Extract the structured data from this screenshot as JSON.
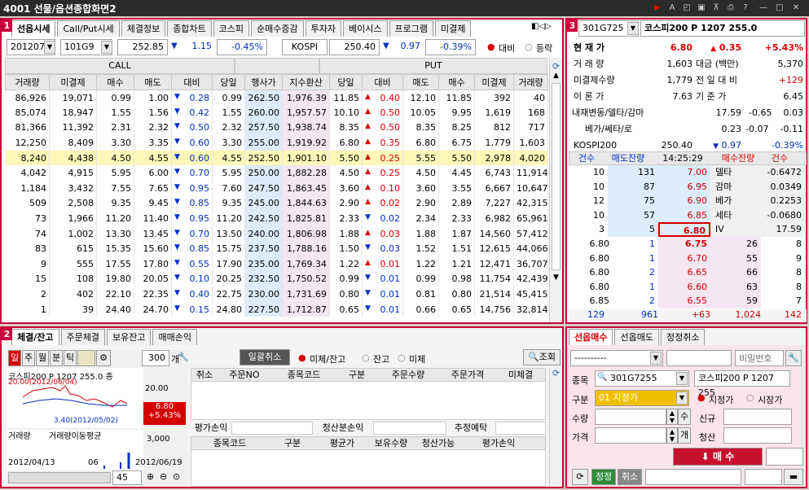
{
  "window": {
    "title": "4001 선물/옵션종합화면2"
  },
  "panel1": {
    "tabs": [
      "선옵시세",
      "Call/Put시세",
      "체결정보",
      "종합차트",
      "코스피",
      "순매수증감",
      "투자자",
      "베이시스",
      "프로그램",
      "미결제"
    ],
    "month": "201207",
    "fut_code": "101G9",
    "fut_price": "252.85",
    "fut_change": "1.15",
    "fut_rate": "-0.45%",
    "kospi_label": "KOSPI",
    "kospi_price": "250.40",
    "kospi_change": "0.97",
    "kospi_rate": "-0.39%",
    "radio_diff": "대비",
    "radio_rate": "등락",
    "call_label": "CALL",
    "put_label": "PUT",
    "headers": [
      "거래량",
      "미결제",
      "매수",
      "매도",
      "대비",
      "당일",
      "행사가",
      "지수환산",
      "당일",
      "대비",
      "매도",
      "매수",
      "미결제",
      "거래량"
    ],
    "rows": [
      [
        "86,926",
        "19,071",
        "0.99",
        "1.00",
        "dn",
        "0.28",
        "0.99",
        "262.50",
        "1,976.39",
        "11.85",
        "up",
        "0.40",
        "12.10",
        "11.85",
        "392",
        "40"
      ],
      [
        "85,074",
        "18,947",
        "1.55",
        "1.56",
        "dn",
        "0.42",
        "1.55",
        "260.00",
        "1,957.57",
        "10.10",
        "up",
        "0.50",
        "10.05",
        "9.95",
        "1,619",
        "168"
      ],
      [
        "81,366",
        "11,392",
        "2.31",
        "2.32",
        "dn",
        "0.50",
        "2.32",
        "257.50",
        "1,938.74",
        "8.35",
        "up",
        "0.50",
        "8.35",
        "8.25",
        "812",
        "717"
      ],
      [
        "12,250",
        "8,409",
        "3.30",
        "3.35",
        "dn",
        "0.60",
        "3.30",
        "255.00",
        "1,919.92",
        "6.80",
        "up",
        "0.35",
        "6.80",
        "6.75",
        "1,779",
        "1,603"
      ],
      [
        "8,240",
        "4,438",
        "4.50",
        "4.55",
        "dn",
        "0.60",
        "4.55",
        "252.50",
        "1,901.10",
        "5.50",
        "up",
        "0.25",
        "5.55",
        "5.50",
        "2,978",
        "4,020"
      ],
      [
        "4,042",
        "4,915",
        "5.95",
        "6.00",
        "dn",
        "0.70",
        "5.95",
        "250.00",
        "1,882.28",
        "4.50",
        "up",
        "0.25",
        "4.50",
        "4.45",
        "6,743",
        "11,914"
      ],
      [
        "1,184",
        "3,432",
        "7.55",
        "7.65",
        "dn",
        "0.95",
        "7.60",
        "247.50",
        "1,863.45",
        "3.60",
        "up",
        "0.10",
        "3.60",
        "3.55",
        "6,667",
        "10,647"
      ],
      [
        "509",
        "2,508",
        "9.35",
        "9.45",
        "dn",
        "0.85",
        "9.35",
        "245.00",
        "1,844.63",
        "2.90",
        "up",
        "0.02",
        "2.90",
        "2.89",
        "7,227",
        "42,315"
      ],
      [
        "73",
        "1,966",
        "11.20",
        "11.40",
        "dn",
        "0.95",
        "11.20",
        "242.50",
        "1,825.81",
        "2.33",
        "dn",
        "0.02",
        "2.34",
        "2.33",
        "6,982",
        "65,961"
      ],
      [
        "74",
        "1,002",
        "13.30",
        "13.45",
        "dn",
        "0.70",
        "13.50",
        "240.00",
        "1,806.98",
        "1.88",
        "up",
        "0.03",
        "1.88",
        "1.87",
        "14,560",
        "57,412"
      ],
      [
        "83",
        "615",
        "15.35",
        "15.60",
        "dn",
        "0.85",
        "15.75",
        "237.50",
        "1,788.16",
        "1.50",
        "dn",
        "0.03",
        "1.52",
        "1.51",
        "12,615",
        "44,066"
      ],
      [
        "9",
        "555",
        "17.55",
        "17.80",
        "dn",
        "0.55",
        "17.90",
        "235.00",
        "1,769.34",
        "1.22",
        "up",
        "0.01",
        "1.22",
        "1.21",
        "12,471",
        "36,707"
      ],
      [
        "15",
        "108",
        "19.80",
        "20.05",
        "dn",
        "0.10",
        "20.25",
        "232.50",
        "1,750.52",
        "0.99",
        "dn",
        "0.01",
        "0.99",
        "0.98",
        "11,754",
        "42,439"
      ],
      [
        "2",
        "402",
        "22.10",
        "22.35",
        "dn",
        "0.40",
        "22.75",
        "230.00",
        "1,731.69",
        "0.80",
        "dn",
        "0.01",
        "0.81",
        "0.80",
        "21,514",
        "45,415"
      ],
      [
        "1",
        "39",
        "24.40",
        "24.70",
        "dn",
        "0.15",
        "24.80",
        "227.50",
        "1,712.87",
        "0.65",
        "dn",
        "0.01",
        "0.66",
        "0.65",
        "14,756",
        "32,814"
      ]
    ]
  },
  "panel3": {
    "code": "301G725",
    "name": "코스피200 P 1207 255.0",
    "cur_label": "현 재 가",
    "cur_price": "6.80",
    "cur_change": "0.35",
    "cur_rate": "+5.43%",
    "vol_label": "거 래 량",
    "vol": "1,603",
    "amt_label": "대금 (백만)",
    "amt": "5,370",
    "oi_label": "미결제수량",
    "oi": "1,779",
    "oi_diff_label": "전 일 대 비",
    "oi_diff": "+129",
    "theory_label": "이 론 가",
    "theory": "7.63",
    "base_label": "기 준 가",
    "base": "6.45",
    "greeks1_label": "내재변동/델타/감마",
    "iv": "17.59",
    "delta": "-0.65",
    "gamma": "0.03",
    "greeks2_label": "베가/쎄타/로",
    "vega": "0.23",
    "theta": "-0.07",
    "rho": "-0.11",
    "k200_label": "KOSPI200",
    "k200": "250.40",
    "k200_chg": "0.97",
    "k200_rate": "-0.39%",
    "ob_headers": [
      "건수",
      "매도잔량",
      "14:25:29",
      "매수잔량",
      "건수"
    ],
    "asks": [
      [
        "10",
        "131",
        "7.00"
      ],
      [
        "10",
        "87",
        "6.95"
      ],
      [
        "12",
        "75",
        "6.90"
      ],
      [
        "10",
        "57",
        "6.85"
      ],
      [
        "3",
        "5",
        "6.80"
      ]
    ],
    "greek_side": [
      [
        "델타",
        "-0.6472"
      ],
      [
        "감마",
        "0.0349"
      ],
      [
        "베가",
        "0.2253"
      ],
      [
        "세타",
        "-0.0680"
      ],
      [
        "IV",
        "17.59"
      ]
    ],
    "bids": [
      [
        "6.80",
        "1",
        "6.75",
        "26",
        "8"
      ],
      [
        "6.80",
        "1",
        "6.70",
        "55",
        "9"
      ],
      [
        "6.80",
        "2",
        "6.65",
        "66",
        "8"
      ],
      [
        "6.80",
        "1",
        "6.60",
        "63",
        "8"
      ],
      [
        "6.85",
        "2",
        "6.55",
        "59",
        "7"
      ]
    ],
    "totals": [
      "129",
      "961",
      "+63",
      "1,024",
      "142"
    ]
  },
  "panel2": {
    "tabs": [
      "체결/잔고",
      "주문체결",
      "보유잔고",
      "매매손익"
    ],
    "period": [
      "일",
      "주",
      "월",
      "분",
      "틱"
    ],
    "count": "300",
    "count_unit": "개",
    "cancel_all": "일괄취소",
    "radio1": "미체/잔고",
    "radio2": "잔고",
    "radio3": "미체",
    "search": "조회",
    "order_headers": [
      "취소",
      "주문NO",
      "종목코드",
      "구분",
      "주문수량",
      "주문가격",
      "미체결"
    ],
    "pl_label": "평가손익",
    "liq_label": "청산분손익",
    "est_label": "추정예탁",
    "hold_headers": [
      "종목코드",
      "구분",
      "평균가",
      "보유수량",
      "청산가능",
      "평가손익"
    ],
    "chart_title": "코스피200 P 1207 255.0 종",
    "chart_high": "20.00(2012/06/04)",
    "chart_low": "3.40(2012/05/02)",
    "axis_top": "20.00",
    "axis_bottom": "3,000",
    "price_tag": "6.80",
    "rate_tag": "+5.43%",
    "vol_legend": "거래량",
    "ma_legend": "거래량이동평균",
    "date_start": "2012/04/13",
    "date_mid": "06",
    "date_end": "2012/06/19",
    "zoom": "45",
    "chart_data": {
      "type": "line",
      "title": "코스피200 P 1207 255.0",
      "x": [
        "2012/04/13",
        "06",
        "2012/06/19"
      ],
      "high": {
        "value": 20.0,
        "date": "2012/06/04"
      },
      "low": {
        "value": 3.4,
        "date": "2012/05/02"
      },
      "last": 6.8
    }
  },
  "order": {
    "tabs": [
      "선옵매수",
      "선옵매도",
      "정정취소"
    ],
    "account": "----------",
    "pw_placeholder": "비밀번호",
    "code_label": "종목",
    "code": "301G7255",
    "name": "코스피200 P 1207 255",
    "type_label": "구분",
    "type": "01 지정가",
    "r_limit": "지정가",
    "r_market": "시장가",
    "qty_label": "수량",
    "qty_suffix": "수",
    "price_label": "가격",
    "price_suffix": "개",
    "new_label": "신규",
    "close_label": "청산",
    "buy_btn": "매 수",
    "confirm": "정정",
    "cancel": "취소"
  }
}
